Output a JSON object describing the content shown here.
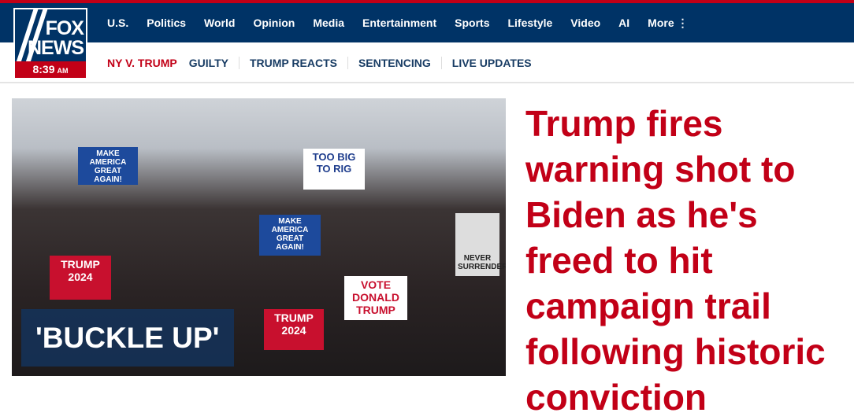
{
  "logo": {
    "line1": "FOX",
    "line2": "NEWS",
    "time": "8:39",
    "ampm": "AM"
  },
  "nav": {
    "items": [
      "U.S.",
      "Politics",
      "World",
      "Opinion",
      "Media",
      "Entertainment",
      "Sports",
      "Lifestyle",
      "Video",
      "AI",
      "More ⋮"
    ]
  },
  "subnav": {
    "items": [
      "NY V. TRUMP",
      "GUILTY",
      "TRUMP REACTS",
      "SENTENCING",
      "LIVE UPDATES"
    ]
  },
  "hero": {
    "label": "'BUCKLE UP'",
    "signs": [
      "MAKE AMERICA GREAT AGAIN!",
      "TOO BIG TO RIG",
      "MAKE AMERICA GREAT AGAIN!",
      "TRUMP 2024",
      "VOTE DONALD TRUMP",
      "NEVER SURRENDER",
      "TRUMP 2024"
    ]
  },
  "headline": "Trump fires warning shot to Biden as he's freed to hit campaign trail following historic conviction",
  "colors": {
    "navy": "#003366",
    "red": "#c20017"
  }
}
